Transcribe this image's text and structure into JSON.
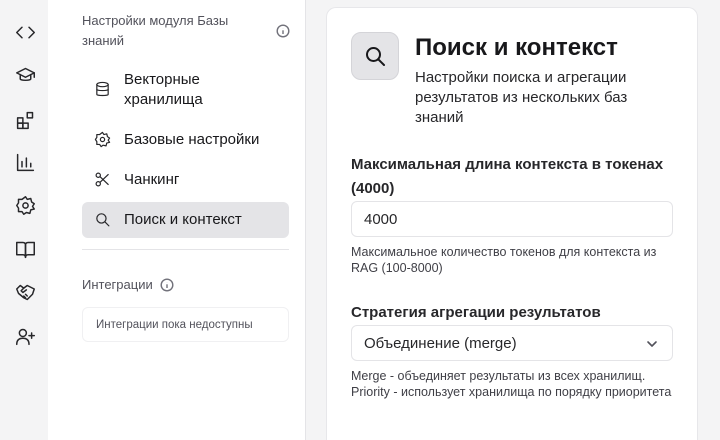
{
  "rail": {
    "icons": [
      "code-icon",
      "graduation-cap-icon",
      "blocks-icon",
      "bar-chart-icon",
      "settings-gear-icon",
      "book-open-icon",
      "handshake-icon",
      "user-plus-icon"
    ]
  },
  "sidebar": {
    "header": "Настройки модуля Базы знаний",
    "items": [
      {
        "label": "Векторные хранилища",
        "icon": "database-icon"
      },
      {
        "label": "Базовые настройки",
        "icon": "gear-icon"
      },
      {
        "label": "Чанкинг",
        "icon": "scissors-icon"
      },
      {
        "label": "Поиск и контекст",
        "icon": "search-icon",
        "active": true
      }
    ],
    "integrations_header": "Интеграции",
    "integrations_empty": "Интеграции пока недоступны"
  },
  "main": {
    "title": "Поиск и контекст",
    "subtitle": "Настройки поиска и агрегации результатов из нескольких баз знаний",
    "max_context": {
      "label": "Максимальная длина контекста в токенах (4000)",
      "value": "4000",
      "hint": "Максимальное количество токенов для контекста из RAG (100-8000)"
    },
    "strategy": {
      "label": "Стратегия агрегации результатов",
      "selected": "Объединение (merge)",
      "hint": "Merge - объединяет результаты из всех хранилищ. Priority - использует хранилища по порядку приоритета"
    }
  },
  "colors": {
    "active_item_bg": "#e4e4e7",
    "rail_bg": "#f4f4f5",
    "text": "#18181b"
  }
}
